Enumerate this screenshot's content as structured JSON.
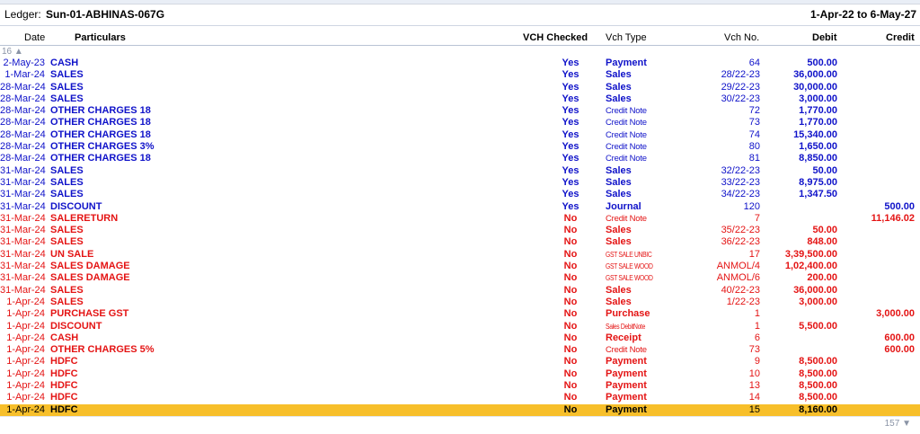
{
  "header": {
    "ledger_label": "Ledger:",
    "ledger_name": "Sun-01-ABHINAS-067G",
    "period": "1-Apr-22 to 6-May-27"
  },
  "columns": {
    "date": "Date",
    "particulars": "Particulars",
    "vch_checked": "VCH Checked",
    "vch_type": "Vch Type",
    "vch_no": "Vch No.",
    "debit": "Debit",
    "credit": "Credit"
  },
  "scroll": {
    "above_count": "16 ▲",
    "below_count": "157 ▼"
  },
  "colors": {
    "checked_yes": "#0f12c9",
    "checked_no": "#e41414",
    "selected_row": "#f7bf2a"
  },
  "rows": [
    {
      "date": "2-May-23",
      "particulars": "CASH",
      "checked": "Yes",
      "type": "Payment",
      "vno": "64",
      "debit": "500.00",
      "credit": ""
    },
    {
      "date": "1-Mar-24",
      "particulars": "SALES",
      "checked": "Yes",
      "type": "Sales",
      "vno": "28/22-23",
      "debit": "36,000.00",
      "credit": ""
    },
    {
      "date": "28-Mar-24",
      "particulars": "SALES",
      "checked": "Yes",
      "type": "Sales",
      "vno": "29/22-23",
      "debit": "30,000.00",
      "credit": ""
    },
    {
      "date": "28-Mar-24",
      "particulars": "SALES",
      "checked": "Yes",
      "type": "Sales",
      "vno": "30/22-23",
      "debit": "3,000.00",
      "credit": ""
    },
    {
      "date": "28-Mar-24",
      "particulars": "OTHER CHARGES 18",
      "checked": "Yes",
      "type": "Credit Note",
      "vno": "72",
      "debit": "1,770.00",
      "credit": ""
    },
    {
      "date": "28-Mar-24",
      "particulars": "OTHER CHARGES 18",
      "checked": "Yes",
      "type": "Credit Note",
      "vno": "73",
      "debit": "1,770.00",
      "credit": ""
    },
    {
      "date": "28-Mar-24",
      "particulars": "OTHER CHARGES 18",
      "checked": "Yes",
      "type": "Credit Note",
      "vno": "74",
      "debit": "15,340.00",
      "credit": ""
    },
    {
      "date": "28-Mar-24",
      "particulars": "OTHER CHARGES 3%",
      "checked": "Yes",
      "type": "Credit Note",
      "vno": "80",
      "debit": "1,650.00",
      "credit": ""
    },
    {
      "date": "28-Mar-24",
      "particulars": "OTHER CHARGES 18",
      "checked": "Yes",
      "type": "Credit Note",
      "vno": "81",
      "debit": "8,850.00",
      "credit": ""
    },
    {
      "date": "31-Mar-24",
      "particulars": "SALES",
      "checked": "Yes",
      "type": "Sales",
      "vno": "32/22-23",
      "debit": "50.00",
      "credit": ""
    },
    {
      "date": "31-Mar-24",
      "particulars": "SALES",
      "checked": "Yes",
      "type": "Sales",
      "vno": "33/22-23",
      "debit": "8,975.00",
      "credit": ""
    },
    {
      "date": "31-Mar-24",
      "particulars": "SALES",
      "checked": "Yes",
      "type": "Sales",
      "vno": "34/22-23",
      "debit": "1,347.50",
      "credit": ""
    },
    {
      "date": "31-Mar-24",
      "particulars": "DISCOUNT",
      "checked": "Yes",
      "type": "Journal",
      "vno": "120",
      "debit": "",
      "credit": "500.00"
    },
    {
      "date": "31-Mar-24",
      "particulars": "SALERETURN",
      "checked": "No",
      "type": "Credit Note",
      "vno": "7",
      "debit": "",
      "credit": "11,146.02"
    },
    {
      "date": "31-Mar-24",
      "particulars": "SALES",
      "checked": "No",
      "type": "Sales",
      "vno": "35/22-23",
      "debit": "50.00",
      "credit": ""
    },
    {
      "date": "31-Mar-24",
      "particulars": "SALES",
      "checked": "No",
      "type": "Sales",
      "vno": "36/22-23",
      "debit": "848.00",
      "credit": ""
    },
    {
      "date": "31-Mar-24",
      "particulars": "UN SALE",
      "checked": "No",
      "type": "GST SALE UNBIC",
      "vno": "17",
      "debit": "3,39,500.00",
      "credit": ""
    },
    {
      "date": "31-Mar-24",
      "particulars": "SALES DAMAGE",
      "checked": "No",
      "type": "GST SALE WOOD",
      "vno": "ANMOL/4",
      "debit": "1,02,400.00",
      "credit": ""
    },
    {
      "date": "31-Mar-24",
      "particulars": "SALES DAMAGE",
      "checked": "No",
      "type": "GST SALE WOOD",
      "vno": "ANMOL/6",
      "debit": "200.00",
      "credit": ""
    },
    {
      "date": "31-Mar-24",
      "particulars": "SALES",
      "checked": "No",
      "type": "Sales",
      "vno": "40/22-23",
      "debit": "36,000.00",
      "credit": ""
    },
    {
      "date": "1-Apr-24",
      "particulars": "SALES",
      "checked": "No",
      "type": "Sales",
      "vno": "1/22-23",
      "debit": "3,000.00",
      "credit": ""
    },
    {
      "date": "1-Apr-24",
      "particulars": "PURCHASE GST",
      "checked": "No",
      "type": "Purchase",
      "vno": "1",
      "debit": "",
      "credit": "3,000.00"
    },
    {
      "date": "1-Apr-24",
      "particulars": "DISCOUNT",
      "checked": "No",
      "type": "Sales DebitNote",
      "vno": "1",
      "debit": "5,500.00",
      "credit": ""
    },
    {
      "date": "1-Apr-24",
      "particulars": "CASH",
      "checked": "No",
      "type": "Receipt",
      "vno": "6",
      "debit": "",
      "credit": "600.00"
    },
    {
      "date": "1-Apr-24",
      "particulars": "OTHER CHARGES  5%",
      "checked": "No",
      "type": "Credit Note",
      "vno": "73",
      "debit": "",
      "credit": "600.00"
    },
    {
      "date": "1-Apr-24",
      "particulars": "HDFC",
      "checked": "No",
      "type": "Payment",
      "vno": "9",
      "debit": "8,500.00",
      "credit": ""
    },
    {
      "date": "1-Apr-24",
      "particulars": "HDFC",
      "checked": "No",
      "type": "Payment",
      "vno": "10",
      "debit": "8,500.00",
      "credit": ""
    },
    {
      "date": "1-Apr-24",
      "particulars": "HDFC",
      "checked": "No",
      "type": "Payment",
      "vno": "13",
      "debit": "8,500.00",
      "credit": ""
    },
    {
      "date": "1-Apr-24",
      "particulars": "HDFC",
      "checked": "No",
      "type": "Payment",
      "vno": "14",
      "debit": "8,500.00",
      "credit": ""
    },
    {
      "date": "1-Apr-24",
      "particulars": "HDFC",
      "checked": "No",
      "type": "Payment",
      "vno": "15",
      "debit": "8,160.00",
      "credit": "",
      "selected": true
    }
  ]
}
